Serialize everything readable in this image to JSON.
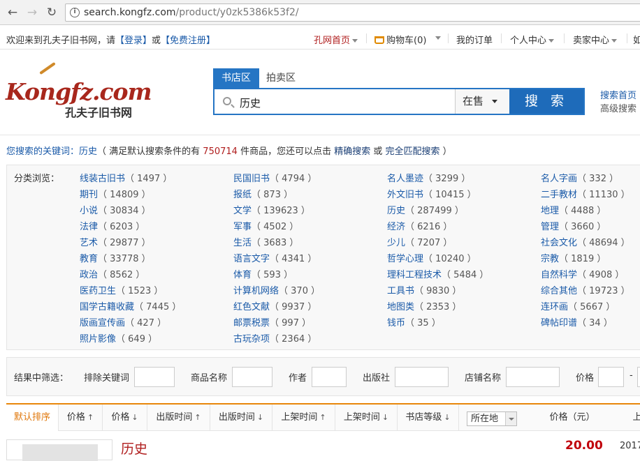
{
  "browser": {
    "url_host": "search.kongfz.com",
    "url_path": "/product/y0zk5386k53f2/"
  },
  "topnav": {
    "welcome": "欢迎来到孔夫子旧书网，请",
    "login": "【登录】",
    "or": "或",
    "register": "【免费注册】",
    "home": "孔网首页",
    "cart": "购物车(0)",
    "orders": "我的订单",
    "user_center": "个人中心",
    "seller_center": "卖家中心",
    "more": "如"
  },
  "logo": {
    "main": "Kongfz.com",
    "sub": "孔夫子旧书网"
  },
  "search": {
    "tabs": [
      "书店区",
      "拍卖区"
    ],
    "query": "历史",
    "status": "在售",
    "button": "搜 索",
    "link_home": "搜索首页",
    "link_advanced": "高级搜索"
  },
  "summary": {
    "prefix": "您搜索的关键词：",
    "keyword": "历史",
    "mid1": "（ 满足默认搜索条件的有 ",
    "count": "750714",
    "mid2": " 件商品，您还可以点击 ",
    "precise": "精确搜索",
    "or": " 或 ",
    "exact": "完全匹配搜索",
    "end": " ）"
  },
  "categories": {
    "label": "分类浏览：",
    "items": [
      {
        "name": "线装古旧书",
        "count": "（ 1497 ）"
      },
      {
        "name": "民国旧书",
        "count": "（ 4794 ）"
      },
      {
        "name": "名人墨迹",
        "count": "（ 3299 ）"
      },
      {
        "name": "名人字画",
        "count": "（ 332 ）"
      },
      {
        "name": "期刊",
        "count": "（ 14809 ）"
      },
      {
        "name": "报纸",
        "count": "（ 873 ）"
      },
      {
        "name": "外文旧书",
        "count": "（ 10415 ）"
      },
      {
        "name": "二手教材",
        "count": "（ 11130 ）"
      },
      {
        "name": "小说",
        "count": "（ 30834 ）"
      },
      {
        "name": "文学",
        "count": "（ 139623 ）"
      },
      {
        "name": "历史",
        "count": "（ 287499 ）"
      },
      {
        "name": "地理",
        "count": "（ 4488 ）"
      },
      {
        "name": "法律",
        "count": "（ 6203 ）"
      },
      {
        "name": "军事",
        "count": "（ 4502 ）"
      },
      {
        "name": "经济",
        "count": "（ 6216 ）"
      },
      {
        "name": "管理",
        "count": "（ 3660 ）"
      },
      {
        "name": "艺术",
        "count": "（ 29877 ）"
      },
      {
        "name": "生活",
        "count": "（ 3683 ）"
      },
      {
        "name": "少儿",
        "count": "（ 7207 ）"
      },
      {
        "name": "社会文化",
        "count": "（ 48694 ）"
      },
      {
        "name": "教育",
        "count": "（ 33778 ）"
      },
      {
        "name": "语言文字",
        "count": "（ 4341 ）"
      },
      {
        "name": "哲学心理",
        "count": "（ 10240 ）"
      },
      {
        "name": "宗教",
        "count": "（ 1819 ）"
      },
      {
        "name": "政治",
        "count": "（ 8562 ）"
      },
      {
        "name": "体育",
        "count": "（ 593 ）"
      },
      {
        "name": "理科工程技术",
        "count": "（ 5484 ）"
      },
      {
        "name": "自然科学",
        "count": "（ 4908 ）"
      },
      {
        "name": "医药卫生",
        "count": "（ 1523 ）"
      },
      {
        "name": "计算机网络",
        "count": "（ 370 ）"
      },
      {
        "name": "工具书",
        "count": "（ 9830 ）"
      },
      {
        "name": "综合其他",
        "count": "（ 19723 ）"
      },
      {
        "name": "国学古籍收藏",
        "count": "（ 7445 ）"
      },
      {
        "name": "红色文献",
        "count": "（ 9937 ）"
      },
      {
        "name": "地图类",
        "count": "（ 2353 ）"
      },
      {
        "name": "连环画",
        "count": "（ 5667 ）"
      },
      {
        "name": "版画宣传画",
        "count": "（ 427 ）"
      },
      {
        "name": "邮票税票",
        "count": "（ 997 ）"
      },
      {
        "name": "钱币",
        "count": "（ 35 ）"
      },
      {
        "name": "碑帖印谱",
        "count": "（ 34 ）"
      },
      {
        "name": "照片影像",
        "count": "（ 649 ）"
      },
      {
        "name": "古玩杂项",
        "count": "（ 2364 ）"
      }
    ]
  },
  "filter": {
    "label": "结果中筛选：",
    "exclude": "排除关键词",
    "product_name": "商品名称",
    "author": "作者",
    "publisher": "出版社",
    "shop_name": "店铺名称",
    "price": "价格",
    "dash": "-"
  },
  "sort": {
    "items": [
      "默认排序",
      "价格",
      "价格",
      "出版时间",
      "出版时间",
      "上架时间",
      "上架时间",
      "书店等级"
    ],
    "arrows": [
      "",
      "🡑",
      "🡓",
      "🡑",
      "🡓",
      "🡑",
      "🡓",
      "🡓"
    ],
    "location": "所在地",
    "price_col": "价格（元）",
    "extra_col": "上"
  },
  "result": {
    "title": "历史",
    "price": "20.00",
    "date": "2017"
  }
}
